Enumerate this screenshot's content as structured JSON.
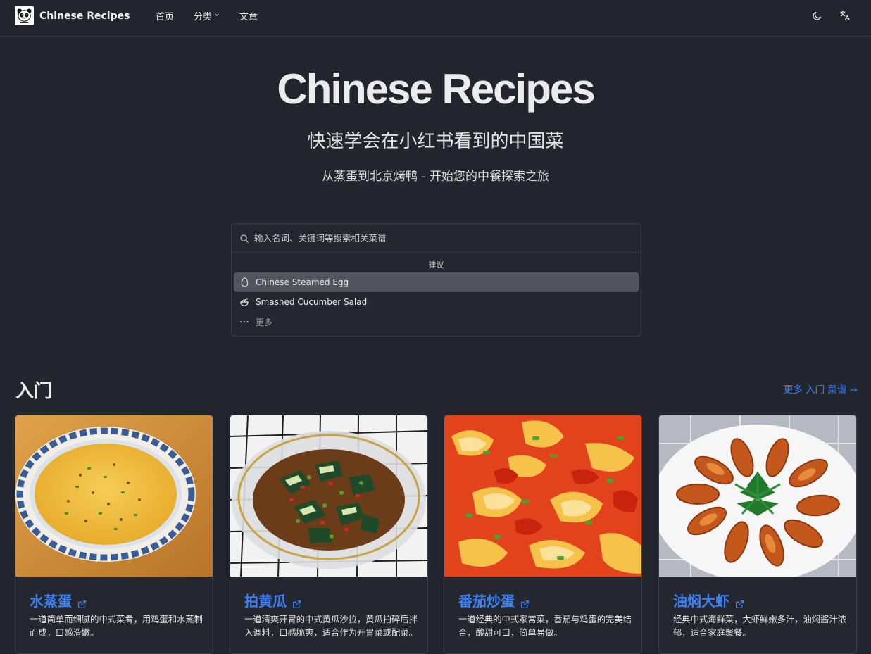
{
  "brand": {
    "name": "Chinese Recipes",
    "logo_icon": "panda-icon"
  },
  "nav": {
    "links": [
      {
        "label": "首页"
      },
      {
        "label": "分类",
        "has_dropdown": true
      },
      {
        "label": "文章"
      }
    ],
    "actions": [
      {
        "icon": "moon-icon"
      },
      {
        "icon": "translate-icon"
      }
    ]
  },
  "hero": {
    "title": "Chinese Recipes",
    "subtitle": "快速学会在小红书看到的中国菜",
    "tagline": "从蒸蛋到北京烤鸭 - 开始您的中餐探索之旅"
  },
  "search": {
    "placeholder": "输入名词、关键词等搜索相关菜谱",
    "value": "",
    "suggest_heading": "建议",
    "suggestions": [
      {
        "label": "Chinese Steamed Egg",
        "icon": "egg-icon",
        "active": true
      },
      {
        "label": "Smashed Cucumber Salad",
        "icon": "salad-bowl-icon",
        "active": false
      }
    ],
    "more_label": "更多"
  },
  "section": {
    "title": "入门",
    "more_link": "更多 入门 菜谱 →",
    "cards": [
      {
        "title": "水蒸蛋",
        "desc": "一道简单而细腻的中式菜肴，用鸡蛋和水蒸制而成，口感滑嫩。"
      },
      {
        "title": "拍黄瓜",
        "desc": "一道清爽开胃的中式黄瓜沙拉，黄瓜拍碎后拌入调料，口感脆爽，适合作为开胃菜或配菜。"
      },
      {
        "title": "番茄炒蛋",
        "desc": "一道经典的中式家常菜，番茄与鸡蛋的完美结合，酸甜可口，简单易做。"
      },
      {
        "title": "油焖大虾",
        "desc": "经典中式海鲜菜，大虾鲜嫩多汁，油焖酱汁浓郁，适合家庭聚餐。"
      }
    ]
  },
  "colors": {
    "background": "#22252d",
    "accent": "#3b82f6",
    "active_suggestion": "#52555e"
  }
}
